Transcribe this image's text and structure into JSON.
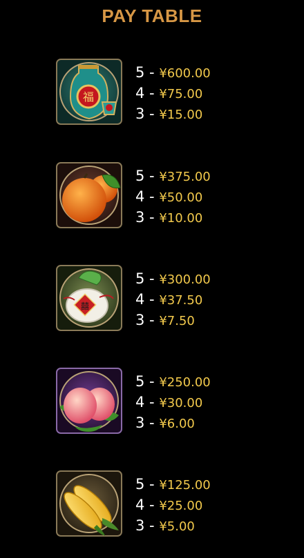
{
  "title": "PAY TABLE",
  "colors": {
    "title": "#d79745",
    "count_text": "#ffffff",
    "amount_text": "#f2c94c",
    "background": "#000000"
  },
  "symbols": [
    {
      "name": "vase-icon",
      "pays": [
        {
          "count": "5",
          "sep": " - ",
          "amount": "¥600.00"
        },
        {
          "count": "4",
          "sep": " - ",
          "amount": "¥75.00"
        },
        {
          "count": "3",
          "sep": " - ",
          "amount": "¥15.00"
        }
      ]
    },
    {
      "name": "orange-icon",
      "pays": [
        {
          "count": "5",
          "sep": " - ",
          "amount": "¥375.00"
        },
        {
          "count": "4",
          "sep": " - ",
          "amount": "¥50.00"
        },
        {
          "count": "3",
          "sep": " - ",
          "amount": "¥10.00"
        }
      ]
    },
    {
      "name": "bun-icon",
      "pays": [
        {
          "count": "5",
          "sep": " - ",
          "amount": "¥300.00"
        },
        {
          "count": "4",
          "sep": " - ",
          "amount": "¥37.50"
        },
        {
          "count": "3",
          "sep": " - ",
          "amount": "¥7.50"
        }
      ]
    },
    {
      "name": "peach-icon",
      "pays": [
        {
          "count": "5",
          "sep": " - ",
          "amount": "¥250.00"
        },
        {
          "count": "4",
          "sep": " - ",
          "amount": "¥30.00"
        },
        {
          "count": "3",
          "sep": " - ",
          "amount": "¥6.00"
        }
      ]
    },
    {
      "name": "corn-icon",
      "pays": [
        {
          "count": "5",
          "sep": " - ",
          "amount": "¥125.00"
        },
        {
          "count": "4",
          "sep": " - ",
          "amount": "¥25.00"
        },
        {
          "count": "3",
          "sep": " - ",
          "amount": "¥5.00"
        }
      ]
    }
  ]
}
